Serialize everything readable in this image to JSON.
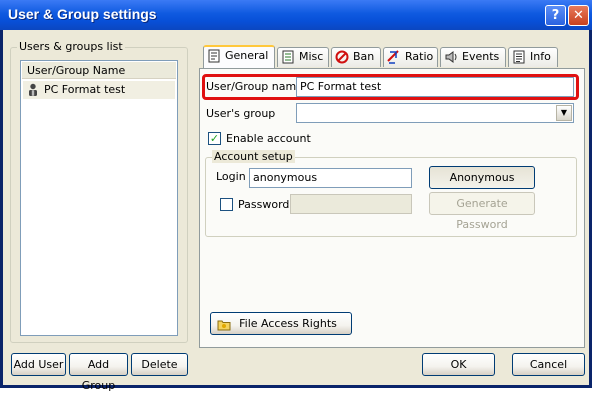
{
  "window": {
    "title": "User & Group settings",
    "help_glyph": "?",
    "close_glyph": "✕"
  },
  "users_groups": {
    "legend": "Users & groups list",
    "column_header": "User/Group Name",
    "items": [
      {
        "label": "PC Format test",
        "icon": "user-icon",
        "selected": true
      }
    ],
    "add_user": "Add User",
    "add_group": "Add Group",
    "delete": "Delete"
  },
  "tabs": [
    {
      "label": "General",
      "icon": "general-icon",
      "active": true
    },
    {
      "label": "Misc",
      "icon": "misc-icon",
      "active": false
    },
    {
      "label": "Ban",
      "icon": "ban-icon",
      "active": false
    },
    {
      "label": "Ratio",
      "icon": "ratio-icon",
      "active": false
    },
    {
      "label": "Events",
      "icon": "events-icon",
      "active": false
    },
    {
      "label": "Info",
      "icon": "info-icon",
      "active": false
    }
  ],
  "general": {
    "name_label": "User/Group name",
    "name_value": "PC Format test",
    "group_label": "User's group",
    "group_value": "",
    "enable_label": "Enable account",
    "enable_checked": true,
    "account_setup": {
      "legend": "Account setup",
      "login_label": "Login",
      "login_value": "anonymous",
      "anon_button": "Anonymous Access",
      "password_label": "Password",
      "password_checked": false,
      "password_value": "",
      "generate_button": "Generate Password"
    },
    "file_access_button": "File Access Rights"
  },
  "footer": {
    "ok": "OK",
    "cancel": "Cancel"
  },
  "colors": {
    "title_bar": "#0f5ae0",
    "dialog_bg": "#ece9d8",
    "highlight": "#e01010",
    "active_tab_accent": "#ffc83c"
  }
}
